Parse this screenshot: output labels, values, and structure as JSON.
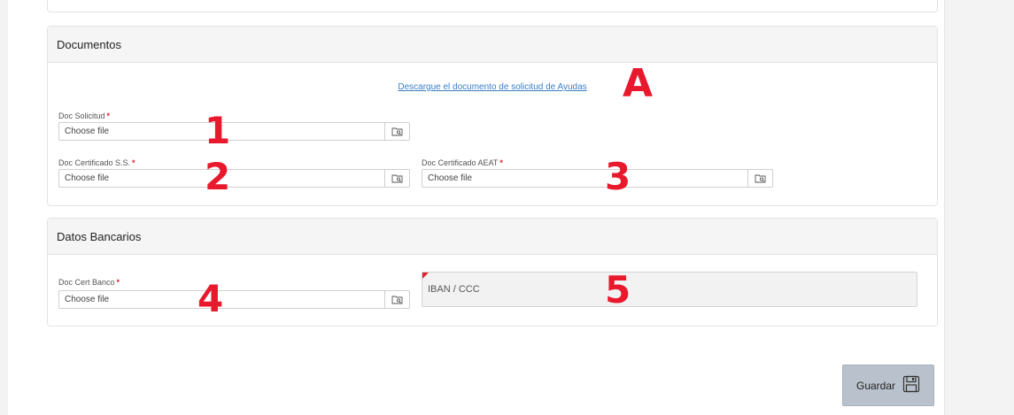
{
  "documentos": {
    "title": "Documentos",
    "download_link": "Descargue el documento de solicitud de Ayudas",
    "fields": {
      "solicitud": {
        "label": "Doc Solicitud",
        "placeholder": "Choose file"
      },
      "cert_ss": {
        "label": "Doc Certificado S.S.",
        "placeholder": "Choose file"
      },
      "cert_aeat": {
        "label": "Doc Certificado AEAT",
        "placeholder": "Choose file"
      }
    }
  },
  "datos_bancarios": {
    "title": "Datos Bancarios",
    "fields": {
      "cert_banco": {
        "label": "Doc Cert Banco",
        "placeholder": "Choose file"
      },
      "iban": {
        "label": "IBAN / CCC"
      }
    }
  },
  "required_mark": "*",
  "annotations": {
    "a": "A",
    "n1": "1",
    "n2": "2",
    "n3": "3",
    "n4": "4",
    "n5": "5"
  },
  "save_button": {
    "label": "Guardar",
    "icon": "floppy-disk-icon"
  },
  "colors": {
    "required": "#e0202a",
    "annotation": "#e8192c",
    "link": "#3a7ec6",
    "button": "#b9c2cc"
  }
}
